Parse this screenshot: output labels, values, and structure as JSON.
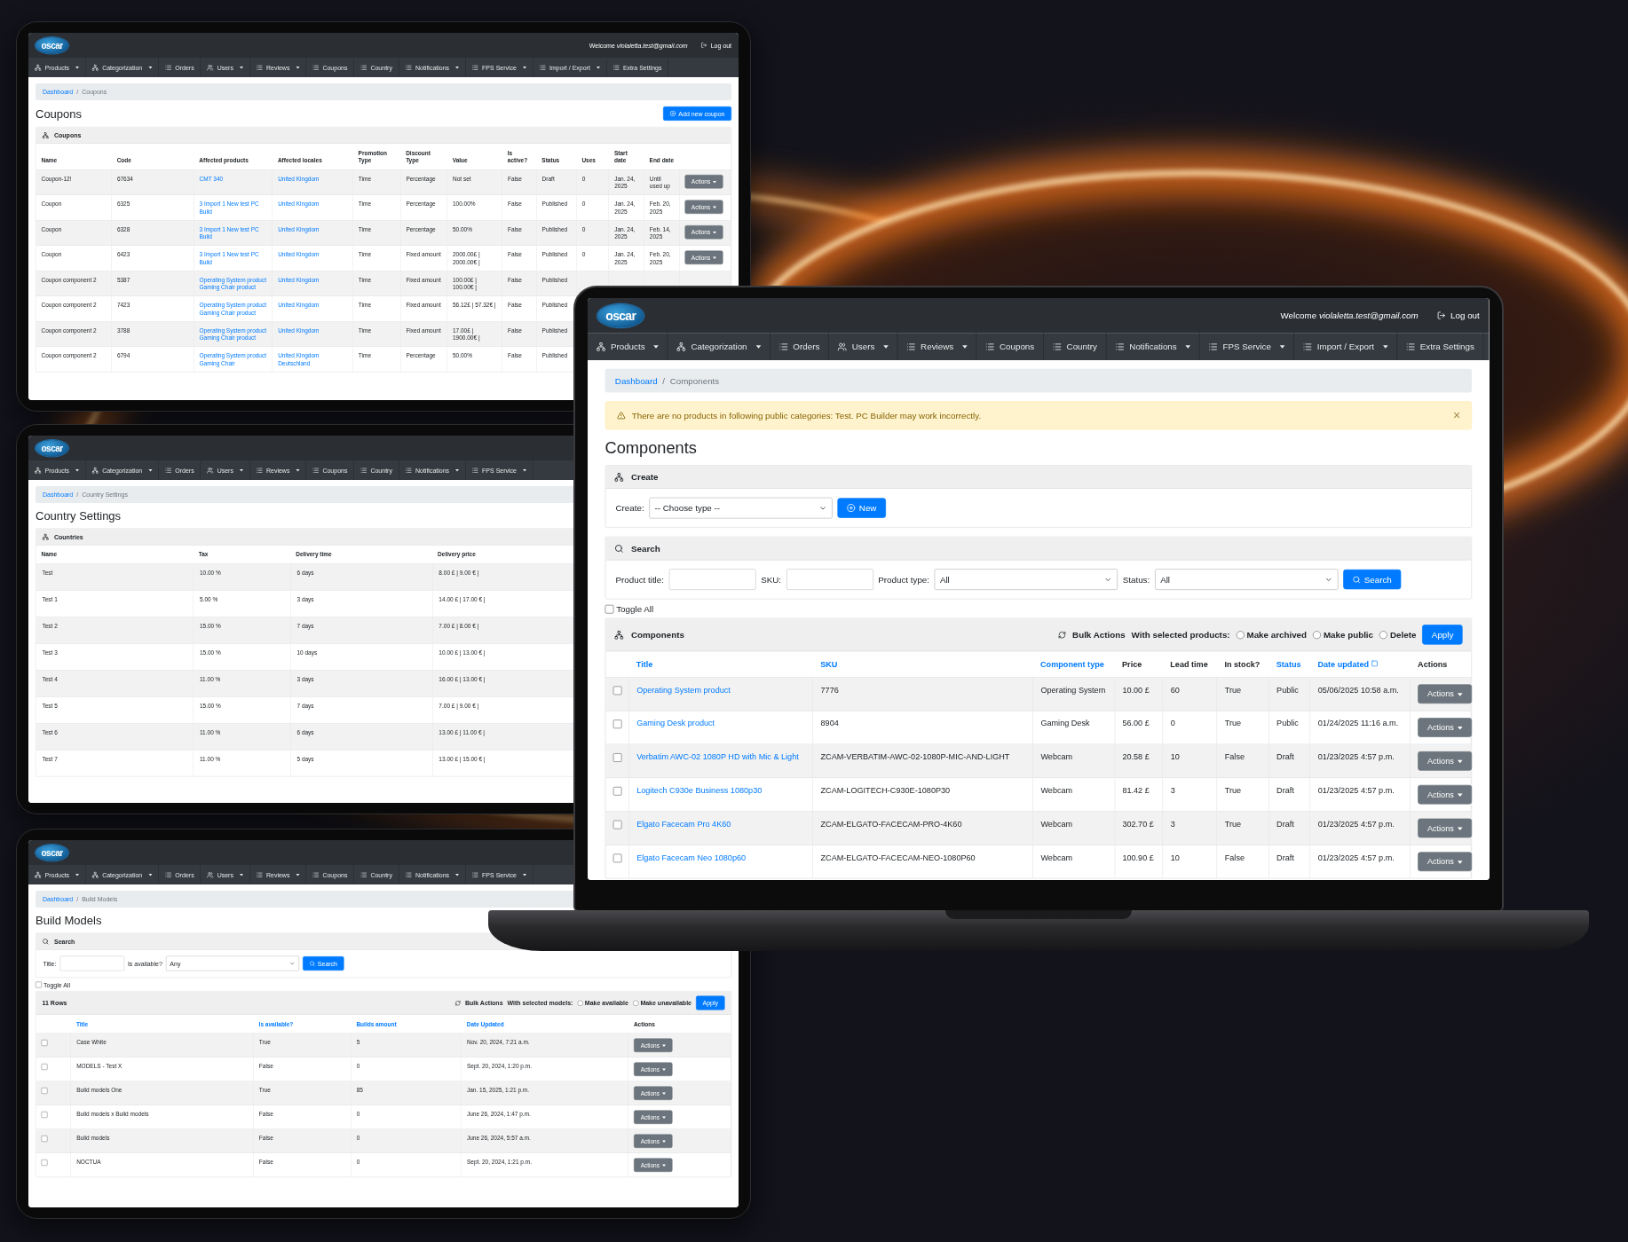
{
  "coupons_tablet": {
    "header": {
      "logo": "oscar",
      "welcome": "Welcome *violaletta.test@gmail.com*",
      "logout": "Log out"
    },
    "nav": [
      {
        "label": "Products",
        "kind": "tree",
        "dropdown": true
      },
      {
        "label": "Categorization",
        "kind": "tree",
        "dropdown": true
      },
      {
        "label": "Orders",
        "kind": "list",
        "dropdown": false
      },
      {
        "label": "Users",
        "kind": "users",
        "dropdown": true
      },
      {
        "label": "Reviews",
        "kind": "list",
        "dropdown": true
      },
      {
        "label": "Coupons",
        "kind": "list",
        "dropdown": false
      },
      {
        "label": "Country",
        "kind": "list",
        "dropdown": false
      },
      {
        "label": "Notifications",
        "kind": "list",
        "dropdown": true
      },
      {
        "label": "FPS Service",
        "kind": "list",
        "dropdown": true
      },
      {
        "label": "Import / Export",
        "kind": "list",
        "dropdown": true
      },
      {
        "label": "Extra Settings",
        "kind": "list",
        "dropdown": false
      }
    ],
    "breadcrumb": {
      "separator": "/",
      "items": [
        "Dashboard",
        "Coupons"
      ]
    },
    "title": "Coupons",
    "add_button": "Add new coupon",
    "table": {
      "title": "Coupons",
      "columns": [
        {
          "label": "Name",
          "link": false
        },
        {
          "label": "Code",
          "link": false
        },
        {
          "label": "Affected products",
          "link": true
        },
        {
          "label": "Affected locales",
          "link": true
        },
        {
          "label": "Promotion Type",
          "link": false
        },
        {
          "label": "Discount Type",
          "link": false
        },
        {
          "label": "Value",
          "link": false
        },
        {
          "label": "Is active?",
          "link": false
        },
        {
          "label": "Status",
          "link": false
        },
        {
          "label": "Uses",
          "link": false
        },
        {
          "label": "Start date",
          "link": false
        },
        {
          "label": "End date",
          "link": false
        }
      ],
      "rows": [
        {
          "cells": [
            "Coupon-12!",
            "67634",
            "CMT 340",
            "United Kingdom",
            "Time",
            "Percentage",
            "Not set",
            "False",
            "Draft",
            "0",
            "Jan. 24, 2025",
            "Until used up"
          ],
          "action": "Actions"
        },
        {
          "cells": [
            "Coupon",
            "6325",
            "3 Import 1 New test PC Build",
            "United Kingdom",
            "Time",
            "Percentage",
            "100.00%",
            "False",
            "Published",
            "0",
            "Jan. 24, 2025",
            "Feb. 20, 2025"
          ],
          "action": "Actions"
        },
        {
          "cells": [
            "Coupon",
            "6328",
            "3 Import 1 New test PC Build",
            "United Kingdom",
            "Time",
            "Percentage",
            "50.00%",
            "False",
            "Published",
            "0",
            "Jan. 24, 2025",
            "Feb. 14, 2025"
          ],
          "action": "Actions"
        },
        {
          "cells": [
            "Coupon",
            "6423",
            "3 Import 1 New test PC Build",
            "United Kingdom",
            "Time",
            "Fixed amount",
            "2000.00£ | 2000.00€ |",
            "False",
            "Published",
            "0",
            "Jan. 24, 2025",
            "Feb. 20, 2025"
          ],
          "action": "Actions"
        },
        {
          "cells": [
            "Coupon component 2",
            "5387",
            "Operating System product Gaming Chair product",
            "United Kingdom",
            "Time",
            "Fixed amount",
            "100.00£ | 100.00€ |",
            "False",
            "Published"
          ]
        },
        {
          "cells": [
            "Coupon component 2",
            "7423",
            "Operating System product Gaming Chair product",
            "United Kingdom",
            "Time",
            "Fixed amount",
            "56.12£ | 57.32€ |",
            "False",
            "Published"
          ]
        },
        {
          "cells": [
            "Coupon component 2",
            "3788",
            "Operating System product Gaming Chair product",
            "United Kingdom",
            "Time",
            "Fixed amount",
            "17.00£ | 1900.00€ |",
            "False",
            "Published"
          ]
        },
        {
          "cells": [
            "Coupon component 2",
            "6794",
            "Operating System product Gaming Chair",
            "United Kingdom Deutschland",
            "Time",
            "Percentage",
            "50.00%",
            "False",
            "Published"
          ]
        }
      ]
    }
  },
  "countries_tablet": {
    "header": {
      "logo": "oscar"
    },
    "nav": [
      {
        "label": "Products",
        "kind": "tree",
        "dropdown": true
      },
      {
        "label": "Categorization",
        "kind": "tree",
        "dropdown": true
      },
      {
        "label": "Orders",
        "kind": "list",
        "dropdown": false
      },
      {
        "label": "Users",
        "kind": "users",
        "dropdown": true
      },
      {
        "label": "Reviews",
        "kind": "list",
        "dropdown": true
      },
      {
        "label": "Coupons",
        "kind": "list",
        "dropdown": false
      },
      {
        "label": "Country",
        "kind": "list",
        "dropdown": false
      },
      {
        "label": "Notifications",
        "kind": "list",
        "dropdown": true
      },
      {
        "label": "FPS Service",
        "kind": "list",
        "dropdown": true
      }
    ],
    "breadcrumb": {
      "separator": "/",
      "items": [
        "Dashboard",
        "Country Settings"
      ]
    },
    "title": "Country Settings",
    "table": {
      "title": "Countries",
      "columns": [
        {
          "label": "Name"
        },
        {
          "label": "Tax"
        },
        {
          "label": "Delivery time"
        },
        {
          "label": "Delivery price"
        }
      ],
      "rows": [
        {
          "cells": [
            "Test",
            "10.00 %",
            "6 days",
            "8.00 £ | 9.00 € |"
          ]
        },
        {
          "cells": [
            "Test 1",
            "5.00 %",
            "3 days",
            "14.00 £ | 17.00 € |"
          ]
        },
        {
          "cells": [
            "Test 2",
            "15.00 %",
            "7 days",
            "7.00 £ | 8.00 € |"
          ]
        },
        {
          "cells": [
            "Test 3",
            "15.00 %",
            "10 days",
            "10.00 £ | 13.00 € |"
          ]
        },
        {
          "cells": [
            "Test 4",
            "11.00 %",
            "3 days",
            "16.00 £ | 13.00 € |"
          ]
        },
        {
          "cells": [
            "Test 5",
            "15.00 %",
            "7 days",
            "7.00 £ | 9.00 € |"
          ]
        },
        {
          "cells": [
            "Test 6",
            "11.00 %",
            "6 days",
            "13.00 £ | 11.00 € |"
          ]
        },
        {
          "cells": [
            "Test 7",
            "11.00 %",
            "5 days",
            "13.00 £ | 15.00 € |"
          ]
        }
      ]
    }
  },
  "build_models_tablet": {
    "header": {
      "logo": "oscar"
    },
    "nav": [
      {
        "label": "Products",
        "kind": "tree",
        "dropdown": true
      },
      {
        "label": "Categorization",
        "kind": "tree",
        "dropdown": true
      },
      {
        "label": "Orders",
        "kind": "list",
        "dropdown": false
      },
      {
        "label": "Users",
        "kind": "users",
        "dropdown": true
      },
      {
        "label": "Reviews",
        "kind": "list",
        "dropdown": true
      },
      {
        "label": "Coupons",
        "kind": "list",
        "dropdown": false
      },
      {
        "label": "Country",
        "kind": "list",
        "dropdown": false
      },
      {
        "label": "Notifications",
        "kind": "list",
        "dropdown": true
      },
      {
        "label": "FPS Service",
        "kind": "list",
        "dropdown": true
      }
    ],
    "breadcrumb": {
      "separator": "/",
      "items": [
        "Dashboard",
        "Build Models"
      ]
    },
    "title": "Build Models",
    "search": {
      "title": "Search",
      "fields": [
        {
          "label": "Title:",
          "kind": "input"
        },
        {
          "label": "Is available?",
          "kind": "select",
          "value": "Any"
        }
      ],
      "button": "Search"
    },
    "toggle_all": {
      "label": "Toggle All",
      "checked": false
    },
    "table": {
      "title": "11 Rows",
      "bulk": {
        "label": "Bulk Actions",
        "prompt": "With selected models:",
        "options": [
          {
            "label": "Make available",
            "selected": false
          },
          {
            "label": "Make unavailable",
            "selected": false
          }
        ],
        "apply": "Apply"
      },
      "columns": [
        {
          "label": "Title",
          "sortable": true
        },
        {
          "label": "Is available?",
          "sortable": true
        },
        {
          "label": "Builds amount",
          "sortable": true
        },
        {
          "label": "Date Updated",
          "sortable": true
        }
      ],
      "actions_header": "Actions",
      "rows": [
        {
          "checked": false,
          "cells": [
            "Case White",
            "True",
            "5",
            "Nov. 20, 2024, 7:21 a.m."
          ],
          "action": "Actions"
        },
        {
          "checked": false,
          "cells": [
            "MODELS - Test X",
            "False",
            "0",
            "Sept. 20, 2024, 1:20 p.m."
          ],
          "action": "Actions"
        },
        {
          "checked": false,
          "cells": [
            "Build models One",
            "True",
            "85",
            "Jan. 15, 2025, 1:21 p.m."
          ],
          "action": "Actions"
        },
        {
          "checked": false,
          "cells": [
            "Build models x Build models",
            "False",
            "0",
            "June 26, 2024, 1:47 p.m."
          ],
          "action": "Actions"
        },
        {
          "checked": false,
          "cells": [
            "Build models",
            "False",
            "0",
            "June 26, 2024, 5:57 a.m."
          ],
          "action": "Actions"
        },
        {
          "checked": false,
          "cells": [
            "NOCTUA",
            "False",
            "0",
            "Sept. 20, 2024, 1:21 p.m."
          ],
          "action": "Actions"
        }
      ]
    }
  },
  "components_laptop": {
    "header": {
      "logo": "oscar",
      "welcome": "Welcome *violaletta.test@gmail.com*",
      "logout": "Log out"
    },
    "nav": [
      {
        "label": "Products",
        "kind": "tree",
        "dropdown": true
      },
      {
        "label": "Categorization",
        "kind": "tree",
        "dropdown": true
      },
      {
        "label": "Orders",
        "kind": "list",
        "dropdown": false
      },
      {
        "label": "Users",
        "kind": "users",
        "dropdown": true
      },
      {
        "label": "Reviews",
        "kind": "list",
        "dropdown": true
      },
      {
        "label": "Coupons",
        "kind": "list",
        "dropdown": false
      },
      {
        "label": "Country",
        "kind": "list",
        "dropdown": false
      },
      {
        "label": "Notifications",
        "kind": "list",
        "dropdown": true
      },
      {
        "label": "FPS Service",
        "kind": "list",
        "dropdown": true
      },
      {
        "label": "Import / Export",
        "kind": "list",
        "dropdown": true
      },
      {
        "label": "Extra Settings",
        "kind": "list",
        "dropdown": false
      }
    ],
    "breadcrumb": {
      "separator": "/",
      "items": [
        "Dashboard",
        "Components"
      ]
    },
    "alert": {
      "text": "There are no products in following public categories: Test. PC Builder may work incorrectly.",
      "close": "×"
    },
    "title": "Components",
    "create": {
      "title": "Create",
      "label": "Create:",
      "value": "-- Choose type --",
      "button": "New"
    },
    "search": {
      "title": "Search",
      "fields": [
        {
          "label": "Product title:",
          "kind": "input"
        },
        {
          "label": "SKU:",
          "kind": "input"
        },
        {
          "label": "Product type:",
          "kind": "select",
          "value": "All"
        },
        {
          "label": "Status:",
          "kind": "select",
          "value": "All"
        }
      ],
      "button": "Search"
    },
    "toggle_all": {
      "label": "Toggle All",
      "checked": false
    },
    "table": {
      "title": "Components",
      "bulk": {
        "label": "Bulk Actions",
        "prompt": "With selected products:",
        "options": [
          {
            "label": "Make archived",
            "selected": false
          },
          {
            "label": "Make public",
            "selected": false
          },
          {
            "label": "Delete",
            "selected": false
          }
        ],
        "apply": "Apply"
      },
      "columns": [
        {
          "label": "Title",
          "sortable": true,
          "link": true
        },
        {
          "label": "SKU",
          "sortable": true,
          "link": false
        },
        {
          "label": "Component type",
          "sortable": true,
          "link": false
        },
        {
          "label": "Price",
          "sortable": false,
          "link": false
        },
        {
          "label": "Lead time",
          "sortable": false,
          "link": false
        },
        {
          "label": "In stock?",
          "sortable": false,
          "link": false
        },
        {
          "label": "Status",
          "sortable": true,
          "link": false
        },
        {
          "label": "Date updated",
          "sortable": true,
          "link": false,
          "sort_icon": true
        }
      ],
      "actions_header": "Actions",
      "rows": [
        {
          "checked": false,
          "cells": [
            "Operating System product",
            "7776",
            "Operating System",
            "10.00 £",
            "60",
            "True",
            "Public",
            "05/06/2025 10:58 a.m."
          ],
          "action": "Actions"
        },
        {
          "checked": false,
          "cells": [
            "Gaming Desk product",
            "8904",
            "Gaming Desk",
            "56.00 £",
            "0",
            "True",
            "Public",
            "01/24/2025 11:16 a.m."
          ],
          "action": "Actions"
        },
        {
          "checked": false,
          "cells": [
            "Verbatim AWC-02 1080P HD with Mic & Light",
            "ZCAM-VERBATIM-AWC-02-1080P-MIC-AND-LIGHT",
            "Webcam",
            "20.58 £",
            "10",
            "False",
            "Draft",
            "01/23/2025 4:57 p.m."
          ],
          "action": "Actions"
        },
        {
          "checked": false,
          "cells": [
            "Logitech C930e Business 1080p30",
            "ZCAM-LOGITECH-C930E-1080P30",
            "Webcam",
            "81.42 £",
            "3",
            "True",
            "Draft",
            "01/23/2025 4:57 p.m."
          ],
          "action": "Actions"
        },
        {
          "checked": false,
          "cells": [
            "Elgato Facecam Pro 4K60",
            "ZCAM-ELGATO-FACECAM-PRO-4K60",
            "Webcam",
            "302.70 £",
            "3",
            "True",
            "Draft",
            "01/23/2025 4:57 p.m."
          ],
          "action": "Actions"
        },
        {
          "checked": false,
          "cells": [
            "Elgato Facecam Neo 1080p60",
            "ZCAM-ELGATO-FACECAM-NEO-1080P60",
            "Webcam",
            "100.90 £",
            "10",
            "False",
            "Draft",
            "01/23/2025 4:57 p.m."
          ],
          "action": "Actions"
        }
      ]
    }
  }
}
